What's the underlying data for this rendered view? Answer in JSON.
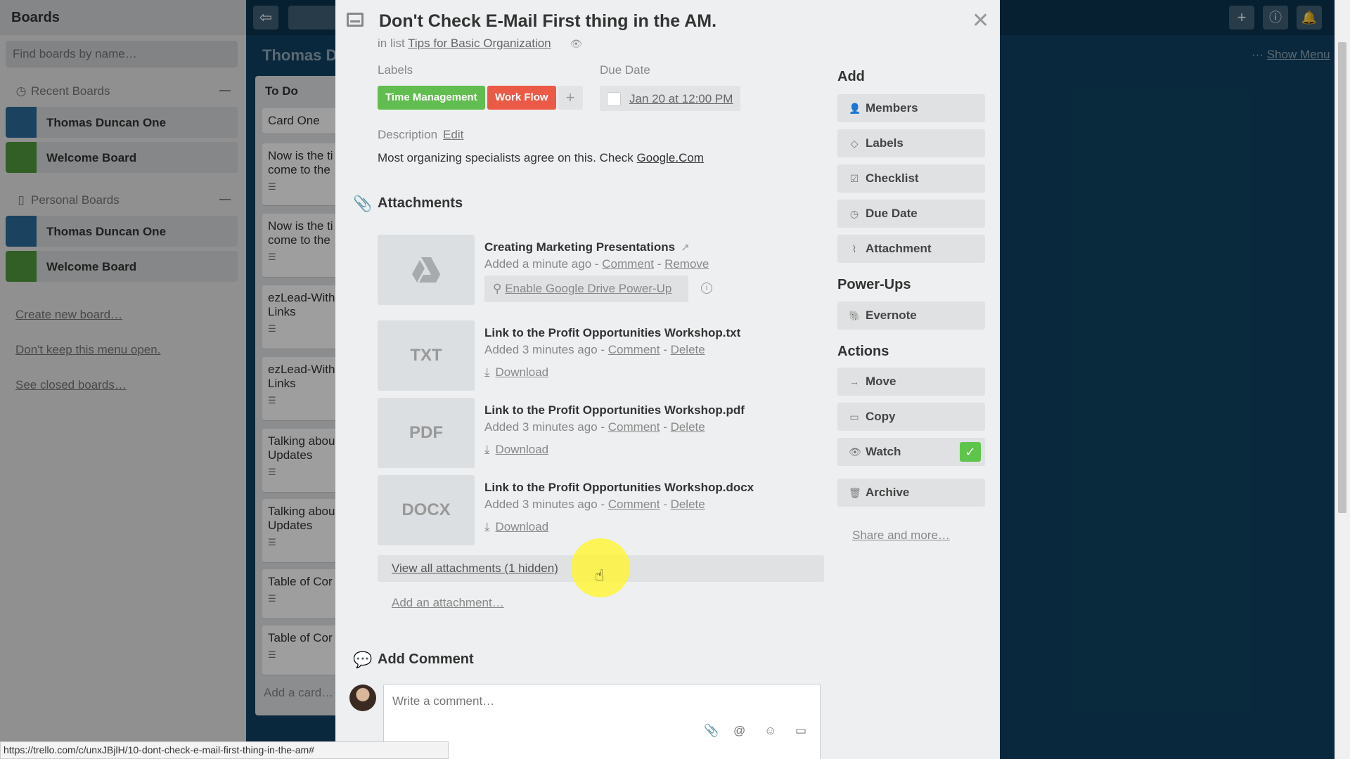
{
  "sidebar": {
    "title": "Boards",
    "search_placeholder": "Find boards by name…",
    "recent_label": "Recent Boards",
    "recent": [
      {
        "name": "Thomas Duncan One",
        "color": "#2d6c9a"
      },
      {
        "name": "Welcome Board",
        "color": "#4f9a3c"
      }
    ],
    "personal_label": "Personal Boards",
    "personal": [
      {
        "name": "Thomas Duncan One",
        "color": "#2d6c9a"
      },
      {
        "name": "Welcome Board",
        "color": "#4f9a3c"
      }
    ],
    "create_link": "Create new board…",
    "keep_link": "Don't keep this menu open.",
    "closed_link": "See closed boards…"
  },
  "board": {
    "title": "Thomas D",
    "show_menu": "Show Menu",
    "list_title": "To Do",
    "cards": [
      "Card One",
      "Now is the ti come to the",
      "Now is the ti come to the",
      "ezLead-With Links",
      "ezLead-With Links",
      "Talking abou Updates",
      "Talking abou Updates",
      "Table of Cor",
      "Table of Cor"
    ],
    "add_card": "Add a card…"
  },
  "card": {
    "title": "Don't Check E-Mail First thing in the AM.",
    "in_list_prefix": "in list",
    "list_name": "Tips for Basic Organization",
    "labels_heading": "Labels",
    "labels": [
      {
        "text": "Time Management",
        "color": "#61bd4f"
      },
      {
        "text": "Work Flow",
        "color": "#eb5a46"
      }
    ],
    "label_add": "+",
    "due_heading": "Due Date",
    "due_value": "Jan 20 at 12:00 PM",
    "description_heading": "Description",
    "description_edit": "Edit",
    "description_text": "Most organizing specialists agree on this. Check",
    "description_link": "Google.Com",
    "attachments_heading": "Attachments",
    "attachments": [
      {
        "thumb": "",
        "name": "Creating Marketing Presentations",
        "added": "Added a minute ago",
        "action1": "Comment",
        "action2": "Remove",
        "extra": "Enable Google Drive Power-Up"
      },
      {
        "thumb": "TXT",
        "name": "Link to the Profit Opportunities Workshop.txt",
        "added": "Added 3 minutes ago",
        "action1": "Comment",
        "action2": "Delete",
        "extra": "Download"
      },
      {
        "thumb": "PDF",
        "name": "Link to the Profit Opportunities Workshop.pdf",
        "added": "Added 3 minutes ago",
        "action1": "Comment",
        "action2": "Delete",
        "extra": "Download"
      },
      {
        "thumb": "DOCX",
        "name": "Link to the Profit Opportunities Workshop.docx",
        "added": "Added 3 minutes ago",
        "action1": "Comment",
        "action2": "Delete",
        "extra": "Download"
      }
    ],
    "view_all": "View all attachments (1 hidden)",
    "add_attachment": "Add an attachment…",
    "add_comment_heading": "Add Comment",
    "comment_placeholder": "Write a comment…"
  },
  "actions_panel": {
    "add_heading": "Add",
    "add_buttons": [
      "Members",
      "Labels",
      "Checklist",
      "Due Date",
      "Attachment"
    ],
    "powerups_heading": "Power-Ups",
    "powerups": [
      "Evernote"
    ],
    "actions_heading": "Actions",
    "action_buttons": [
      "Move",
      "Copy",
      "Watch",
      "Archive"
    ],
    "share_link": "Share and more…"
  },
  "status_url": "https://trello.com/c/unxJBjlH/10-dont-check-e-mail-first-thing-in-the-am#",
  "colors": {
    "accent_green": "#61bd4f",
    "accent_red": "#eb5a46",
    "watch_check": "#5fc44a",
    "cursor_halo": "#fff53c"
  },
  "icons": {
    "card": "card-icon",
    "close": "close-icon",
    "attachment": "paperclip-icon",
    "comment": "speech-bubble-icon",
    "watch": "eye-icon",
    "drive": "google-drive-icon",
    "download": "download-icon"
  }
}
